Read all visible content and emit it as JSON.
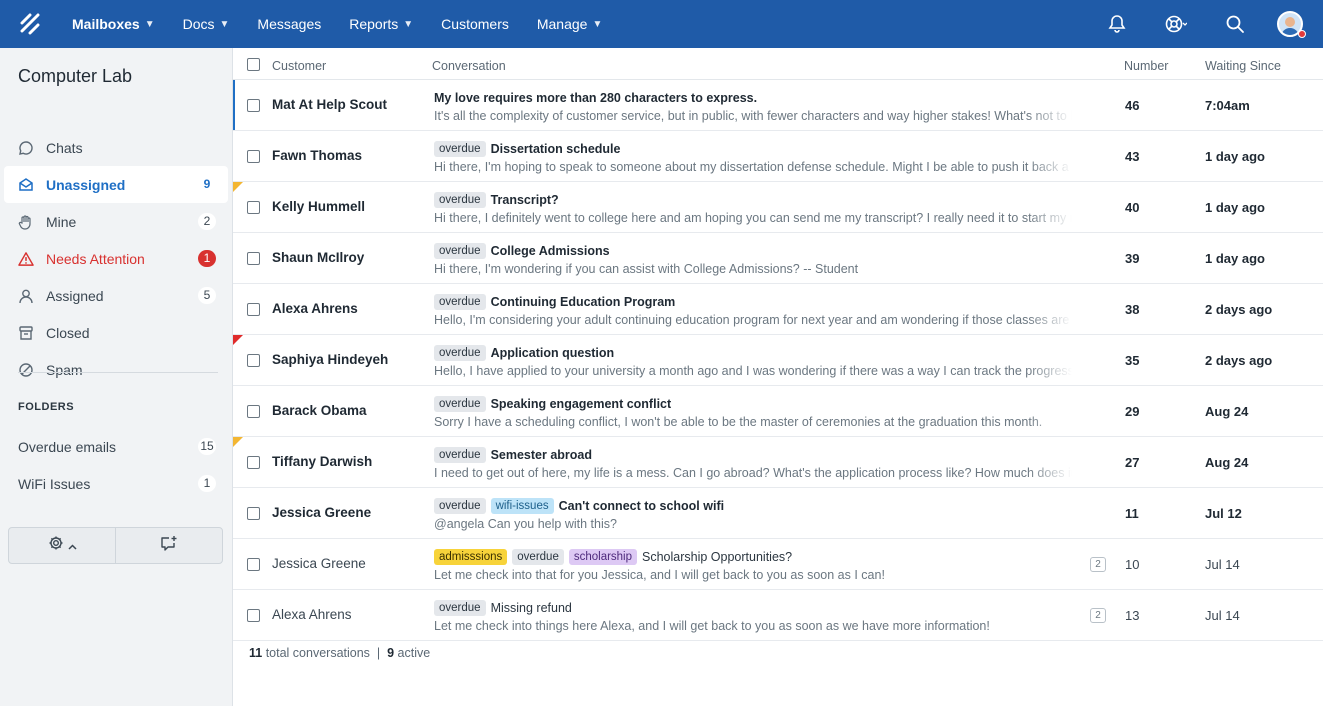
{
  "nav": {
    "items": [
      {
        "label": "Mailboxes",
        "dropdown": true
      },
      {
        "label": "Docs",
        "dropdown": true
      },
      {
        "label": "Messages",
        "dropdown": false
      },
      {
        "label": "Reports",
        "dropdown": true
      },
      {
        "label": "Customers",
        "dropdown": false
      },
      {
        "label": "Manage",
        "dropdown": true
      }
    ],
    "icons": [
      "logo-icon",
      "bell-icon",
      "help-lifebuoy-icon",
      "search-icon",
      "avatar"
    ]
  },
  "sidebar": {
    "mailbox_name": "Computer Lab",
    "items": [
      {
        "label": "Chats",
        "icon": "chat-bubble-icon",
        "count": ""
      },
      {
        "label": "Unassigned",
        "icon": "inbox-icon",
        "count": "9"
      },
      {
        "label": "Mine",
        "icon": "hand-icon",
        "count": "2"
      },
      {
        "label": "Needs Attention",
        "icon": "warning-icon",
        "count": "1"
      },
      {
        "label": "Assigned",
        "icon": "person-icon",
        "count": "5"
      },
      {
        "label": "Closed",
        "icon": "archive-icon",
        "count": ""
      },
      {
        "label": "Spam",
        "icon": "blocked-icon",
        "count": ""
      }
    ],
    "folders_title": "FOLDERS",
    "folders": [
      {
        "label": "Overdue emails",
        "count": "15"
      },
      {
        "label": "WiFi Issues",
        "count": "1"
      }
    ]
  },
  "table": {
    "headers": {
      "customer": "Customer",
      "conversation": "Conversation",
      "number": "Number",
      "waiting": "Waiting Since"
    },
    "rows": [
      {
        "customer": "Mat At Help Scout",
        "tags": [],
        "subject": "My love requires more than 280 characters to express.",
        "preview": "It's all the complexity of customer service, but in public, with fewer characters and way higher stakes! What's not to lo",
        "number": "46",
        "waiting": "7:04am",
        "unread": true,
        "flag": "",
        "thread_count": ""
      },
      {
        "customer": "Fawn Thomas",
        "tags": [
          "overdue"
        ],
        "subject": "Dissertation schedule",
        "preview": "Hi there, I'm hoping to speak to someone about my dissertation defense schedule. Might I be able to push it back a m",
        "number": "43",
        "waiting": "1 day ago",
        "unread": true,
        "flag": "",
        "thread_count": ""
      },
      {
        "customer": "Kelly Hummell",
        "tags": [
          "overdue"
        ],
        "subject": "Transcript?",
        "preview": "Hi there, I definitely went to college here and am hoping you can send me my transcript? I really need it to start my ne",
        "number": "40",
        "waiting": "1 day ago",
        "unread": true,
        "flag": "yellow",
        "thread_count": ""
      },
      {
        "customer": "Shaun McIlroy",
        "tags": [
          "overdue"
        ],
        "subject": "College Admissions",
        "preview": "Hi there, I'm wondering if you can assist with College Admissions? -- Student",
        "number": "39",
        "waiting": "1 day ago",
        "unread": true,
        "flag": "",
        "thread_count": ""
      },
      {
        "customer": "Alexa Ahrens",
        "tags": [
          "overdue"
        ],
        "subject": "Continuing Education Program",
        "preview": "Hello, I'm considering your adult continuing education program for next year and am wondering if those classes are o",
        "number": "38",
        "waiting": "2 days ago",
        "unread": true,
        "flag": "",
        "thread_count": ""
      },
      {
        "customer": "Saphiya Hindeyeh",
        "tags": [
          "overdue"
        ],
        "subject": "Application question",
        "preview": "Hello, I have applied to your university a month ago and I was wondering if there was a way I can track the progress of",
        "number": "35",
        "waiting": "2 days ago",
        "unread": true,
        "flag": "red",
        "thread_count": ""
      },
      {
        "customer": "Barack Obama",
        "tags": [
          "overdue"
        ],
        "subject": "Speaking engagement conflict",
        "preview": "Sorry I have a scheduling conflict, I won't be able to be the master of ceremonies at the graduation this month.",
        "number": "29",
        "waiting": "Aug 24",
        "unread": true,
        "flag": "",
        "thread_count": ""
      },
      {
        "customer": "Tiffany Darwish",
        "tags": [
          "overdue"
        ],
        "subject": "Semester abroad",
        "preview": "I need to get out of here, my life is a mess. Can I go abroad? What's the application process like? How much does it co",
        "number": "27",
        "waiting": "Aug 24",
        "unread": true,
        "flag": "yellow",
        "thread_count": ""
      },
      {
        "customer": "Jessica Greene",
        "tags": [
          "overdue",
          "wifi-issues"
        ],
        "subject": "Can't connect to school wifi",
        "preview": "@angela Can you help with this?",
        "number": "11",
        "waiting": "Jul 12",
        "unread": true,
        "flag": "",
        "thread_count": ""
      },
      {
        "customer": "Jessica Greene",
        "tags": [
          "admisssions",
          "overdue",
          "scholarship"
        ],
        "subject": "Scholarship Opportunities?",
        "preview": "Let me check into that for you Jessica, and I will get back to you as soon as I can!",
        "number": "10",
        "waiting": "Jul 14",
        "unread": false,
        "flag": "",
        "thread_count": "2"
      },
      {
        "customer": "Alexa Ahrens",
        "tags": [
          "overdue"
        ],
        "subject": "Missing refund",
        "preview": "Let me check into things here Alexa, and I will get back to you as soon as we have more information!",
        "number": "13",
        "waiting": "Jul 14",
        "unread": false,
        "flag": "",
        "thread_count": "2"
      }
    ],
    "tag_colors": {
      "overdue": "#e4e7eb",
      "wifi-issues": "#bde3f8",
      "admisssions": "#f7d33a",
      "scholarship": "#ddc9f4"
    }
  },
  "footer": {
    "total": "11",
    "total_label": "total conversations",
    "separator": "|",
    "active": "9",
    "active_label": "active"
  },
  "colors": {
    "topbar": "#1f5ba8",
    "accent": "#1f6fc5",
    "alert": "#d8312f"
  }
}
